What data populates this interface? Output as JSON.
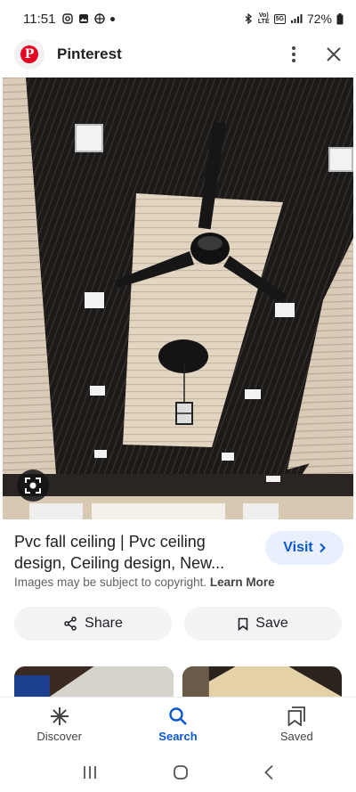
{
  "status_bar": {
    "time": "11:51",
    "network_label_top": "Vo)",
    "network_label_bottom": "LTE",
    "network_5g": "5G",
    "battery": "72%"
  },
  "header": {
    "app_title": "Pinterest",
    "logo_letter": "P"
  },
  "result": {
    "title": "Pvc fall ceiling | Pvc ceiling design, Ceiling design, New...",
    "visit_label": "Visit",
    "copyright_text": "Images may be subject to copyright.",
    "learn_more_label": "Learn More"
  },
  "actions": {
    "share_label": "Share",
    "save_label": "Save"
  },
  "bottom_nav": {
    "discover_label": "Discover",
    "search_label": "Search",
    "saved_label": "Saved"
  },
  "colors": {
    "accent": "#0b57d0",
    "visit_bg": "#e8f0fe",
    "pinterest_red": "#e60023"
  }
}
